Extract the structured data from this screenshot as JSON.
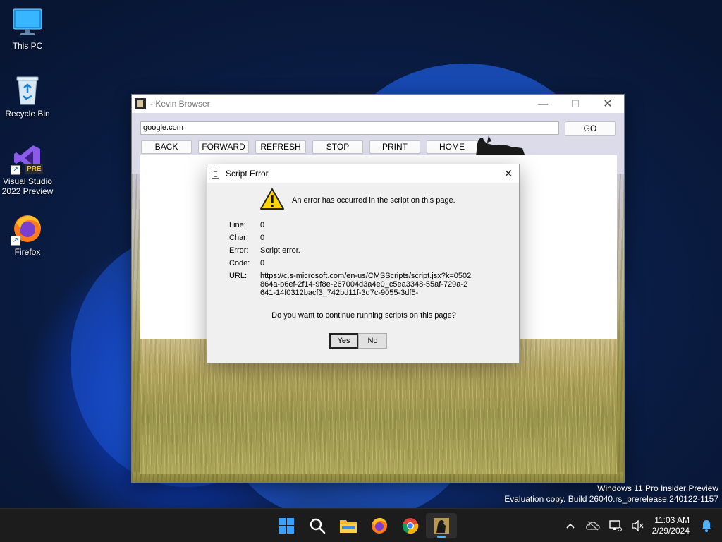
{
  "desktop": {
    "icons": [
      {
        "label": "This PC",
        "icon": "monitor-icon"
      },
      {
        "label": "Recycle Bin",
        "icon": "recycle-bin-icon"
      },
      {
        "label": "Visual Studio 2022 Preview",
        "badge": "PRE",
        "icon": "visual-studio-icon"
      },
      {
        "label": "Firefox",
        "icon": "firefox-icon"
      }
    ],
    "watermark": {
      "line1": "Windows 11 Pro Insider Preview",
      "line2": "Evaluation copy. Build 26040.rs_prerelease.240122-1157"
    }
  },
  "browser": {
    "title": "- Kevin Browser",
    "address_value": "google.com",
    "go_label": "GO",
    "nav": {
      "back": "BACK",
      "forward": "FORWARD",
      "refresh": "REFRESH",
      "stop": "STOP",
      "print": "PRINT",
      "home": "HOME"
    }
  },
  "dialog": {
    "title": "Script Error",
    "message": "An error has occurred in the script on this page.",
    "fields": {
      "line_label": "Line:",
      "line_value": "0",
      "char_label": "Char:",
      "char_value": "0",
      "error_label": "Error:",
      "error_value": "Script error.",
      "code_label": "Code:",
      "code_value": "0",
      "url_label": "URL:",
      "url_value": "https://c.s-microsoft.com/en-us/CMSScripts/script.jsx?k=0502864a-b6ef-2f14-9f8e-267004d3a4e0_c5ea3348-55af-729a-2641-14f0312bacf3_742bd11f-3d7c-9055-3df5-"
    },
    "question": "Do you want to continue running scripts on this page?",
    "yes_label": "Yes",
    "no_label": "No"
  },
  "taskbar": {
    "apps": [
      "start-icon",
      "search-icon",
      "file-explorer-icon",
      "firefox-icon",
      "chrome-icon",
      "kevin-browser-icon"
    ],
    "time": "11:03 AM",
    "date": "2/29/2024"
  }
}
